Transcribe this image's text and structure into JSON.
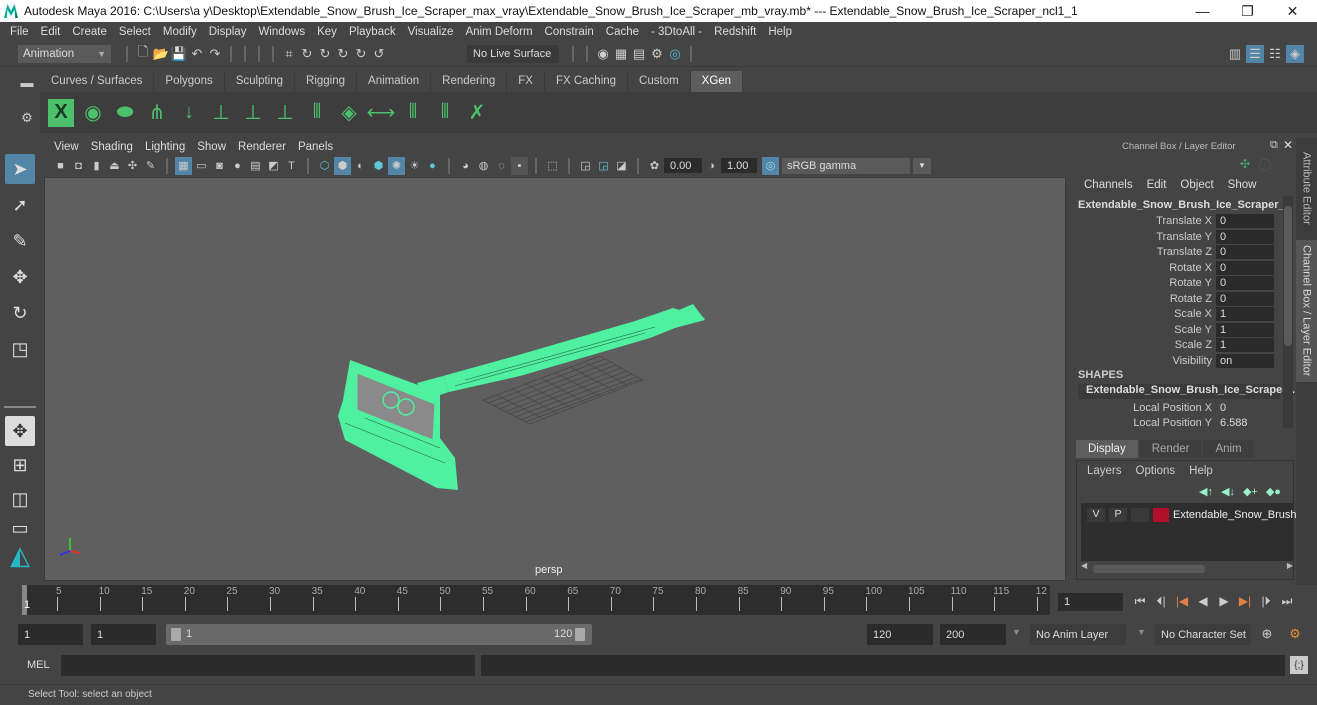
{
  "window": {
    "title": "Autodesk Maya 2016: C:\\Users\\a y\\Desktop\\Extendable_Snow_Brush_Ice_Scraper_max_vray\\Extendable_Snow_Brush_Ice_Scraper_mb_vray.mb*  ---  Extendable_Snow_Brush_Ice_Scraper_ncl1_1",
    "minimize": "—",
    "restore": "❐",
    "close": "✕"
  },
  "menubar": [
    "File",
    "Edit",
    "Create",
    "Select",
    "Modify",
    "Display",
    "Windows",
    "Key",
    "Playback",
    "Visualize",
    "Anim Deform",
    "Constrain",
    "Cache",
    "- 3DtoAll -",
    "Redshift",
    "Help"
  ],
  "statusline": {
    "menuset": "Animation",
    "live_surface": "No Live Surface"
  },
  "shelf": {
    "tabs": [
      "Curves / Surfaces",
      "Polygons",
      "Sculpting",
      "Rigging",
      "Animation",
      "Rendering",
      "FX",
      "FX Caching",
      "Custom",
      "XGen"
    ],
    "active_tab": "XGen"
  },
  "panel": {
    "menu": [
      "View",
      "Shading",
      "Lighting",
      "Show",
      "Renderer",
      "Panels"
    ],
    "exposure": "0.00",
    "gamma": "1.00",
    "color_space": "sRGB gamma",
    "camera_label": "persp"
  },
  "channel_box": {
    "title": "Channel Box / Layer Editor",
    "menu": [
      "Channels",
      "Edit",
      "Object",
      "Show"
    ],
    "object_name": "Extendable_Snow_Brush_Ice_Scraper_...",
    "channels": [
      {
        "label": "Translate X",
        "value": "0"
      },
      {
        "label": "Translate Y",
        "value": "0"
      },
      {
        "label": "Translate Z",
        "value": "0"
      },
      {
        "label": "Rotate X",
        "value": "0"
      },
      {
        "label": "Rotate Y",
        "value": "0"
      },
      {
        "label": "Rotate Z",
        "value": "0"
      },
      {
        "label": "Scale X",
        "value": "1"
      },
      {
        "label": "Scale Y",
        "value": "1"
      },
      {
        "label": "Scale Z",
        "value": "1"
      },
      {
        "label": "Visibility",
        "value": "on"
      }
    ],
    "shapes_header": "SHAPES",
    "shape_name": "Extendable_Snow_Brush_Ice_Scraper...",
    "shape_channels": [
      {
        "label": "Local Position X",
        "value": "0"
      },
      {
        "label": "Local Position Y",
        "value": "6.588"
      }
    ]
  },
  "layer_editor": {
    "tabs": [
      "Display",
      "Render",
      "Anim"
    ],
    "active_tab": "Display",
    "menu": [
      "Layers",
      "Options",
      "Help"
    ],
    "layers": [
      {
        "v": "V",
        "p": "P",
        "color": "#b0102a",
        "name": "Extendable_Snow_Brush"
      }
    ]
  },
  "side_tabs": [
    "Attribute Editor",
    "Channel Box / Layer Editor"
  ],
  "timeline": {
    "ticks": [
      "5",
      "10",
      "15",
      "20",
      "25",
      "30",
      "35",
      "40",
      "45",
      "50",
      "55",
      "60",
      "65",
      "70",
      "75",
      "80",
      "85",
      "90",
      "95",
      "100",
      "105",
      "110",
      "115",
      "12"
    ],
    "current_frame_marker": "1",
    "current_frame": "1"
  },
  "range": {
    "start": "1",
    "anim_start": "1",
    "slider_start": "1",
    "slider_end": "120",
    "end": "120",
    "anim_end": "200",
    "anim_layer": "No Anim Layer",
    "character_set": "No Character Set"
  },
  "command_line": {
    "label": "MEL"
  },
  "help_line": "Select Tool: select an object",
  "colors": {
    "wireframe": "#4ff0a0",
    "accent": "#5285a6",
    "layer_color": "#b0102a"
  }
}
